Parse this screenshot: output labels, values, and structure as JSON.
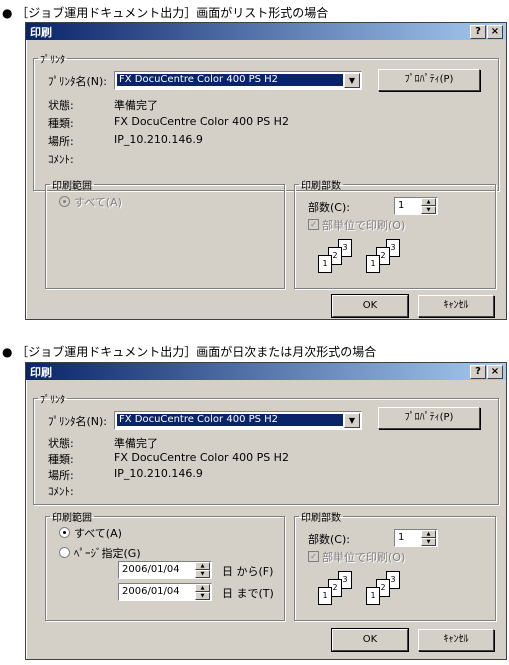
{
  "captions": {
    "top": "● ［ジョブ運用ドキュメント出力］画面がリスト形式の場合",
    "bottom": "● ［ジョブ運用ドキュメント出力］画面が日次または月次形式の場合"
  },
  "dialog": {
    "title": "印刷",
    "help_btn": "?",
    "close_btn": "×",
    "printer_group": "ﾌﾟﾘﾝﾀ",
    "printer_name_label": "ﾌﾟﾘﾝﾀ名(N):",
    "printer_name_value": "FX DocuCentre Color 400 PS H2",
    "properties_btn": "ﾌﾟﾛﾊﾟﾃｨ(P)",
    "status_label": "状態:",
    "status_value": "準備完了",
    "type_label": "種類:",
    "type_value": "FX DocuCentre Color 400 PS H2",
    "location_label": "場所:",
    "location_value": "IP_10.210.146.9",
    "comment_label": "ｺﾒﾝﾄ:",
    "range_group": "印刷範囲",
    "range_all": "すべて(A)",
    "range_page": "ﾍﾟｰｼﾞ指定(G)",
    "date_from": "2006/01/04",
    "date_to": "2006/01/04",
    "from_label": "日 から(F)",
    "to_label": "日 まで(T)",
    "copies_group": "印刷部数",
    "copies_label": "部数(C):",
    "copies_value": "1",
    "collate_label": "部単位で印刷(O)",
    "collate_icon_pages": [
      "1",
      "2",
      "3"
    ],
    "ok_btn": "OK",
    "cancel_btn": "ｷｬﾝｾﾙ"
  }
}
